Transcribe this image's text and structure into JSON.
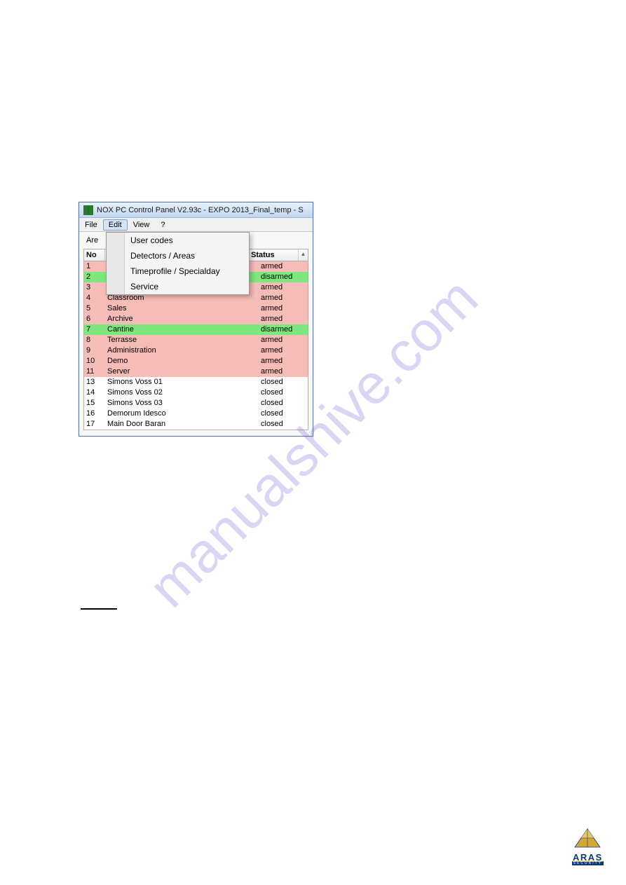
{
  "watermark": "manualshive.com",
  "window": {
    "title": "NOX PC Control Panel V2.93c - EXPO 2013_Final_temp - S"
  },
  "menu": {
    "file": "File",
    "edit": "Edit",
    "view": "View",
    "help": "?"
  },
  "dropdown": {
    "user_codes": "User codes",
    "detectors_areas": "Detectors / Areas",
    "timeprofile": "Timeprofile / Specialday",
    "service": "Service"
  },
  "content": {
    "tab_label": "Are"
  },
  "table": {
    "headers": {
      "no": "No",
      "status": "Status"
    },
    "rows": [
      {
        "no": "1",
        "name": "",
        "status": "armed",
        "state": "armed"
      },
      {
        "no": "2",
        "name": "",
        "status": "disarmed",
        "state": "disarmed"
      },
      {
        "no": "3",
        "name": "",
        "status": "armed",
        "state": "armed"
      },
      {
        "no": "4",
        "name": "Classroom",
        "status": "armed",
        "state": "armed"
      },
      {
        "no": "5",
        "name": "Sales",
        "status": "armed",
        "state": "armed"
      },
      {
        "no": "6",
        "name": "Archive",
        "status": "armed",
        "state": "armed"
      },
      {
        "no": "7",
        "name": "Cantine",
        "status": "disarmed",
        "state": "disarmed"
      },
      {
        "no": "8",
        "name": "Terrasse",
        "status": "armed",
        "state": "armed"
      },
      {
        "no": "9",
        "name": "Administration",
        "status": "armed",
        "state": "armed"
      },
      {
        "no": "10",
        "name": "Demo",
        "status": "armed",
        "state": "armed"
      },
      {
        "no": "11",
        "name": "Server",
        "status": "armed",
        "state": "armed"
      },
      {
        "no": "13",
        "name": "Simons Voss 01",
        "status": "closed",
        "state": "closed"
      },
      {
        "no": "14",
        "name": "Simons Voss 02",
        "status": "closed",
        "state": "closed"
      },
      {
        "no": "15",
        "name": "Simons Voss 03",
        "status": "closed",
        "state": "closed"
      },
      {
        "no": "16",
        "Name": "Demorum Idesco",
        "name": "Demorum Idesco",
        "status": "closed",
        "state": "closed"
      },
      {
        "no": "17",
        "name": "Main Door Baran",
        "status": "closed",
        "state": "closed"
      }
    ]
  },
  "logo": {
    "text": "ARAS",
    "sub": "SECURITY"
  }
}
